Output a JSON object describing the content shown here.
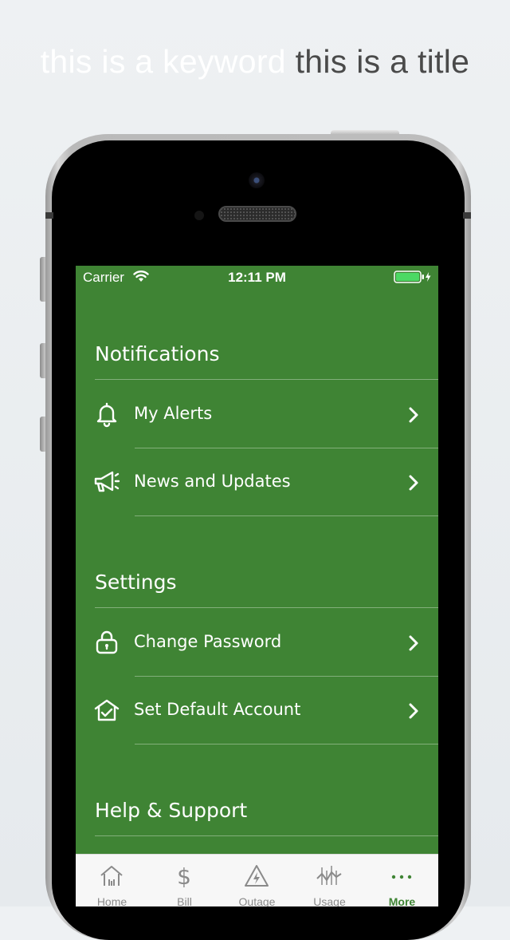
{
  "headline": {
    "keyword": "this is a keyword",
    "title": "this is a title"
  },
  "status_bar": {
    "carrier": "Carrier",
    "time": "12:11 PM"
  },
  "sections": [
    {
      "title": "Notifications",
      "items": [
        {
          "label": "My Alerts",
          "icon": "bell-icon"
        },
        {
          "label": "News and Updates",
          "icon": "megaphone-icon"
        }
      ]
    },
    {
      "title": "Settings",
      "items": [
        {
          "label": "Change Password",
          "icon": "lock-icon"
        },
        {
          "label": "Set Default Account",
          "icon": "home-check-icon"
        }
      ]
    },
    {
      "title": "Help & Support",
      "items": []
    }
  ],
  "tabbar": {
    "active": "More",
    "tabs": [
      {
        "label": "Home",
        "icon": "home-icon"
      },
      {
        "label": "Bill",
        "icon": "dollar-icon"
      },
      {
        "label": "Outage",
        "icon": "outage-icon"
      },
      {
        "label": "Usage",
        "icon": "usage-icon"
      },
      {
        "label": "More",
        "icon": "more-icon"
      }
    ]
  },
  "colors": {
    "brand_green": "#3f8434",
    "tab_inactive": "#8a8a8a",
    "tab_bg": "#f7f7f7"
  }
}
